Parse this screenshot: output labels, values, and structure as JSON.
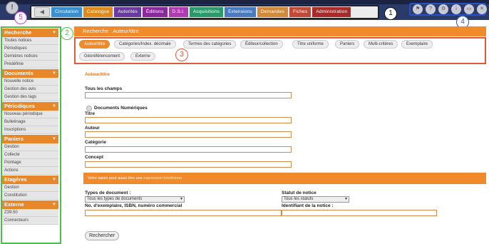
{
  "nav": {
    "tabs": [
      "Circulation",
      "Catalogue",
      "Autorités",
      "Éditions",
      "D.S.I.",
      "Acquisitions",
      "Extensions",
      "Demandes",
      "Fiches",
      "Administration"
    ]
  },
  "badges": {
    "b1": "1",
    "b2": "2",
    "b3": "3",
    "b4": "4",
    "b5": "5"
  },
  "sidebar": {
    "sections": [
      {
        "title": "Recherche",
        "items": [
          "Toutes notices",
          "Périodiques",
          "Dernières notices",
          "Prédéfinie"
        ]
      },
      {
        "title": "Documents",
        "items": [
          "Nouvelle notice",
          "Gestion des avis",
          "Gestion des tags"
        ]
      },
      {
        "title": "Périodiques",
        "items": [
          "Nouveau périodique",
          "Bulletinage",
          "Inscriptions"
        ]
      },
      {
        "title": "Paniers",
        "items": [
          "Gestion",
          "Collecte",
          "Pointage",
          "Actions"
        ]
      },
      {
        "title": "Etagères",
        "items": [
          "Gestion",
          "Constitution"
        ]
      },
      {
        "title": "Externe",
        "items": [
          "Z39.50",
          "Connecteurs"
        ]
      }
    ]
  },
  "breadcrumb": "Recherche : Auteur/titre",
  "search_tabs": [
    "Auteur/titre",
    "Catégories/Index. décimale",
    "Termes des catégories",
    "Éditeur/collection",
    "Titre uniforme",
    "Paniers",
    "Multi-critères",
    "Exemplaire",
    "Géoréférencement",
    "Externe"
  ],
  "form": {
    "title": "Auteur/titre",
    "all_fields_label": "Tous les champs",
    "digital_docs_label": "Documents Numériques",
    "title_label": "Titre",
    "author_label": "Auteur",
    "category_label": "Catégorie",
    "concept_label": "Concept",
    "band_text": "Votre saisie peut aussi être une",
    "band_link": "expression booléenne",
    "doc_type_label": "Types de document :",
    "doc_type_value": "Tous les types de documents",
    "status_label": "Statut de notice",
    "status_value": "Tous les statuts",
    "copy_label": "No. d'exemplaire, ISBN, numéro commercial",
    "id_label": "Identifiant de la notice :",
    "search_button": "Rechercher"
  }
}
